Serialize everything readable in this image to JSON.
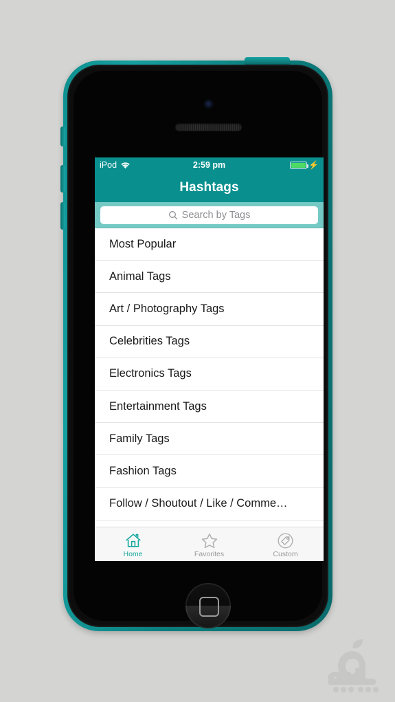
{
  "device": {
    "type": "ipod-touch",
    "bezel_color": "#0e8f8f"
  },
  "status_bar": {
    "carrier": "iPod",
    "wifi_icon": "wifi-icon",
    "time": "2:59 pm",
    "battery_icon": "battery-full-icon",
    "charging_icon": "lightning-bolt-icon",
    "battery_color": "#4cd964"
  },
  "nav_bar": {
    "title": "Hashtags",
    "background_color": "#0a8f8f",
    "title_color": "#ffffff"
  },
  "search": {
    "placeholder": "Search by Tags",
    "value": "",
    "icon": "search-icon",
    "bar_background": "#74c9c5"
  },
  "list": {
    "items": [
      {
        "label": "Most Popular"
      },
      {
        "label": "Animal Tags"
      },
      {
        "label": "Art / Photography Tags"
      },
      {
        "label": "Celebrities Tags"
      },
      {
        "label": "Electronics Tags"
      },
      {
        "label": "Entertainment Tags"
      },
      {
        "label": "Family Tags"
      },
      {
        "label": "Fashion Tags"
      },
      {
        "label": "Follow / Shoutout / Like / Comme…"
      }
    ]
  },
  "tab_bar": {
    "active_color": "#16a8a0",
    "inactive_color": "#9b9b9b",
    "tabs": [
      {
        "label": "Home",
        "icon": "home-icon",
        "active": true
      },
      {
        "label": "Favorites",
        "icon": "star-icon",
        "active": false
      },
      {
        "label": "Custom",
        "icon": "tag-circle-icon",
        "active": false
      }
    ]
  }
}
